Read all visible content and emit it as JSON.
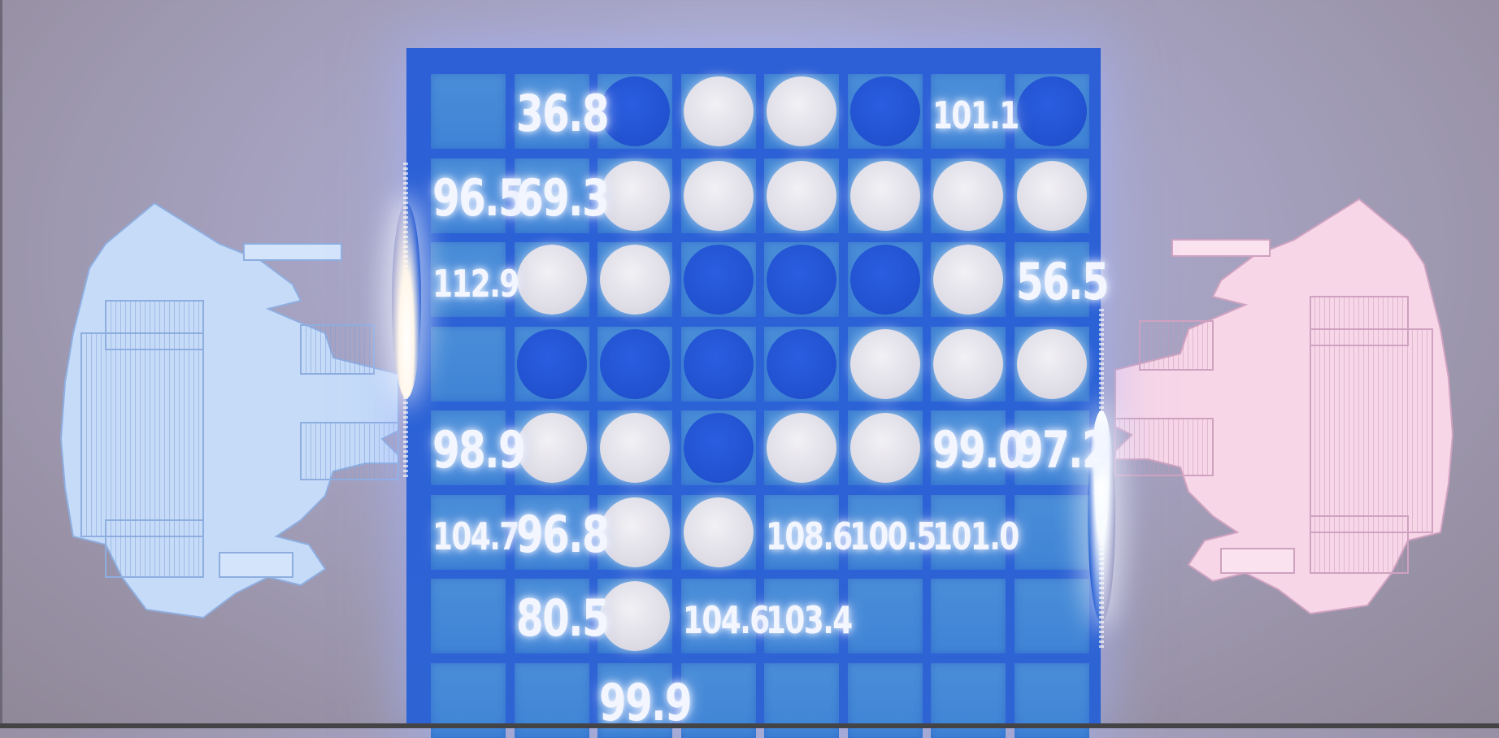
{
  "game": {
    "name": "",
    "board": {
      "columns": 8,
      "rows": 8,
      "grid": [
        [
          "empty",
          "empty",
          "blue",
          "white",
          "white",
          "blue",
          "empty",
          "blue"
        ],
        [
          "empty",
          "empty",
          "white",
          "white",
          "white",
          "white",
          "white",
          "white"
        ],
        [
          "empty",
          "white",
          "white",
          "blue",
          "blue",
          "blue",
          "white",
          "empty"
        ],
        [
          "empty",
          "blue",
          "blue",
          "blue",
          "blue",
          "white",
          "white",
          "white"
        ],
        [
          "empty",
          "white",
          "white",
          "blue",
          "white",
          "white",
          "empty",
          "empty"
        ],
        [
          "empty",
          "empty",
          "white",
          "white",
          "empty",
          "empty",
          "empty",
          "empty"
        ],
        [
          "empty",
          "empty",
          "white",
          "empty",
          "empty",
          "empty",
          "empty",
          "empty"
        ],
        [
          "empty",
          "empty",
          "empty",
          "empty",
          "empty",
          "empty",
          "empty",
          "empty"
        ]
      ]
    },
    "score_labels": [
      {
        "text": "36.8",
        "row": 0,
        "col": 1,
        "size": "large"
      },
      {
        "text": "101.1",
        "row": 0,
        "col": 6,
        "size": "small"
      },
      {
        "text": "96.5",
        "row": 1,
        "col": 0,
        "size": "large"
      },
      {
        "text": "69.3",
        "row": 1,
        "col": 1,
        "size": "large"
      },
      {
        "text": "112.9",
        "row": 2,
        "col": 0,
        "size": "small"
      },
      {
        "text": "56.5",
        "row": 2,
        "col": 7,
        "size": "large"
      },
      {
        "text": "98.9",
        "row": 4,
        "col": 0,
        "size": "large"
      },
      {
        "text": "99.0",
        "row": 4,
        "col": 6,
        "size": "large"
      },
      {
        "text": "97.2",
        "row": 4,
        "col": 7,
        "size": "large"
      },
      {
        "text": "104.7",
        "row": 5,
        "col": 0,
        "size": "small"
      },
      {
        "text": "96.8",
        "row": 5,
        "col": 1,
        "size": "large"
      },
      {
        "text": "108.6",
        "row": 5,
        "col": 4,
        "size": "small"
      },
      {
        "text": "100.5",
        "row": 5,
        "col": 5,
        "size": "small"
      },
      {
        "text": "101.0",
        "row": 5,
        "col": 6,
        "size": "small"
      },
      {
        "text": "80.5",
        "row": 6,
        "col": 1,
        "size": "large"
      },
      {
        "text": "104.6",
        "row": 6,
        "col": 3,
        "size": "small"
      },
      {
        "text": "103.4",
        "row": 6,
        "col": 4,
        "size": "small"
      },
      {
        "text": "99.9",
        "row": 7,
        "col": 2,
        "size": "large"
      }
    ],
    "players": {
      "left": {
        "color": "#bcd4f7",
        "icon": "robot-blue-icon"
      },
      "right": {
        "color": "#f6cfe4",
        "icon": "robot-pink-icon"
      }
    },
    "colors": {
      "board": "#2b62d6",
      "cell": "#4a8ed8",
      "disc_white": "#dfdde6",
      "disc_blue": "#2151cf",
      "label": "#f4f6ff"
    }
  }
}
